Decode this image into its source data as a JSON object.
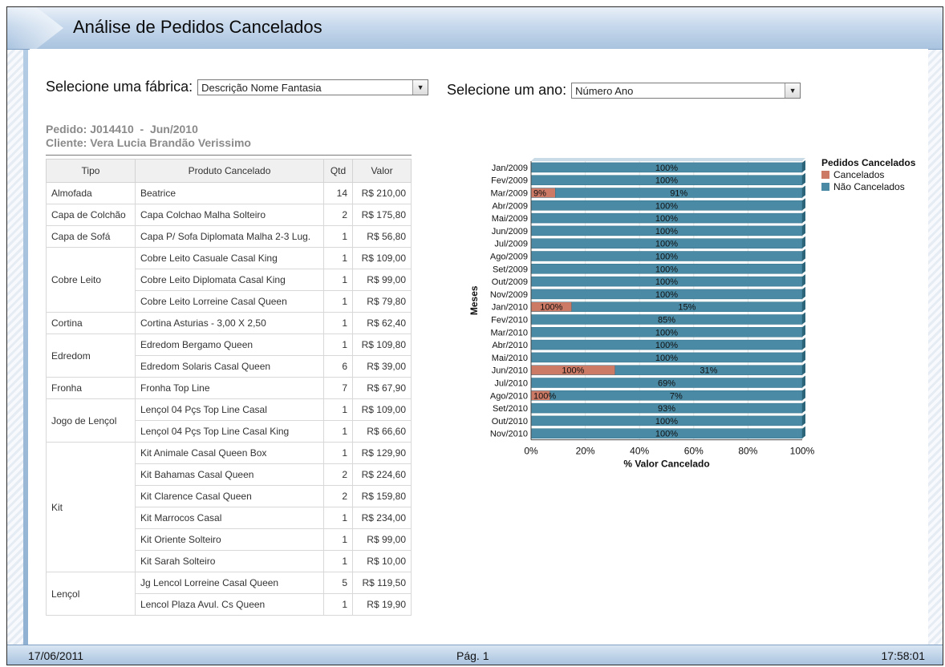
{
  "header": {
    "title": "Análise de Pedidos Cancelados"
  },
  "filters": {
    "factory_label": "Selecione uma fábrica:",
    "factory_value": "Descrição Nome Fantasia",
    "year_label": "Selecione um ano:",
    "year_value": "Número Ano"
  },
  "order": {
    "line1": "Pedido: J014410  -  Jun/2010",
    "line2": "Cliente: Vera Lucia Brandão Verissimo"
  },
  "table": {
    "headers": [
      "Tipo",
      "Produto Cancelado",
      "Qtd",
      "Valor"
    ],
    "rows": [
      {
        "tipo": "Almofada",
        "produto": "Beatrice",
        "qtd": "14",
        "valor": "R$ 210,00",
        "span": 1
      },
      {
        "tipo": "Capa de Colchão",
        "produto": "Capa Colchao Malha Solteiro",
        "qtd": "2",
        "valor": "R$ 175,80",
        "span": 1
      },
      {
        "tipo": "Capa de Sofá",
        "produto": "Capa P/ Sofa Diplomata Malha 2-3 Lug.",
        "qtd": "1",
        "valor": "R$ 56,80",
        "span": 1
      },
      {
        "tipo": "Cobre Leito",
        "produto": "Cobre Leito Casuale Casal King",
        "qtd": "1",
        "valor": "R$ 109,00",
        "span": 3
      },
      {
        "tipo": "",
        "produto": "Cobre Leito Diplomata Casal King",
        "qtd": "1",
        "valor": "R$ 99,00",
        "span": 0
      },
      {
        "tipo": "",
        "produto": "Cobre Leito Lorreine Casal Queen",
        "qtd": "1",
        "valor": "R$ 79,80",
        "span": 0
      },
      {
        "tipo": "Cortina",
        "produto": "Cortina Asturias - 3,00 X 2,50",
        "qtd": "1",
        "valor": "R$ 62,40",
        "span": 1
      },
      {
        "tipo": "Edredom",
        "produto": "Edredom Bergamo Queen",
        "qtd": "1",
        "valor": "R$ 109,80",
        "span": 2
      },
      {
        "tipo": "",
        "produto": "Edredom Solaris Casal Queen",
        "qtd": "6",
        "valor": "R$ 39,00",
        "span": 0
      },
      {
        "tipo": "Fronha",
        "produto": "Fronha Top Line",
        "qtd": "7",
        "valor": "R$ 67,90",
        "span": 1
      },
      {
        "tipo": "Jogo de Lençol",
        "produto": "Lençol 04 Pçs Top Line Casal",
        "qtd": "1",
        "valor": "R$ 109,00",
        "span": 2
      },
      {
        "tipo": "",
        "produto": "Lençol 04 Pçs Top Line Casal King",
        "qtd": "1",
        "valor": "R$ 66,60",
        "span": 0
      },
      {
        "tipo": "Kit",
        "produto": "Kit Animale Casal Queen Box",
        "qtd": "1",
        "valor": "R$ 129,90",
        "span": 6
      },
      {
        "tipo": "",
        "produto": "Kit Bahamas Casal Queen",
        "qtd": "2",
        "valor": "R$ 224,60",
        "span": 0
      },
      {
        "tipo": "",
        "produto": "Kit Clarence Casal Queen",
        "qtd": "2",
        "valor": "R$ 159,80",
        "span": 0
      },
      {
        "tipo": "",
        "produto": "Kit Marrocos Casal",
        "qtd": "1",
        "valor": "R$ 234,00",
        "span": 0
      },
      {
        "tipo": "",
        "produto": "Kit Oriente Solteiro",
        "qtd": "1",
        "valor": "R$ 99,00",
        "span": 0
      },
      {
        "tipo": "",
        "produto": "Kit Sarah Solteiro",
        "qtd": "1",
        "valor": "R$ 10,00",
        "span": 0
      },
      {
        "tipo": "Lençol",
        "produto": "Jg Lencol Lorreine Casal Queen",
        "qtd": "5",
        "valor": "R$ 119,50",
        "span": 2
      },
      {
        "tipo": "",
        "produto": "Lencol Plaza Avul. Cs Queen",
        "qtd": "1",
        "valor": "R$ 19,90",
        "span": 0
      }
    ]
  },
  "chart_data": {
    "type": "bar",
    "orientation": "horizontal",
    "stacked": true,
    "categories": [
      "Jan/2009",
      "Fev/2009",
      "Mar/2009",
      "Abr/2009",
      "Mai/2009",
      "Jun/2009",
      "Jul/2009",
      "Ago/2009",
      "Set/2009",
      "Out/2009",
      "Nov/2009",
      "Jan/2010",
      "Fev/2010",
      "Mar/2010",
      "Abr/2010",
      "Mai/2010",
      "Jun/2010",
      "Jul/2010",
      "Ago/2010",
      "Set/2010",
      "Out/2010",
      "Nov/2010"
    ],
    "series": [
      {
        "name": "Cancelados",
        "color": "#cc7a66",
        "values": [
          0,
          0,
          9,
          0,
          0,
          0,
          0,
          0,
          0,
          0,
          0,
          15,
          0,
          0,
          0,
          0,
          31,
          0,
          7,
          0,
          0,
          0
        ]
      },
      {
        "name": "Não Cancelados",
        "color": "#4a8aa5",
        "values": [
          100,
          100,
          91,
          100,
          100,
          100,
          100,
          100,
          100,
          100,
          100,
          85,
          100,
          100,
          100,
          100,
          69,
          100,
          93,
          100,
          100,
          100
        ]
      }
    ],
    "value_labels": [
      "100%",
      "100%",
      "9%",
      "91%",
      "100%",
      "100%",
      "100%",
      "100%",
      "100%",
      "100%",
      "100%",
      "100%",
      "100%",
      "15%",
      "85%",
      "100%",
      "100%",
      "100%",
      "100%",
      "31%",
      "69%",
      "100%",
      "7%",
      "93%",
      "100%",
      "100%",
      "100%"
    ],
    "xlabel": "% Valor Cancelado",
    "ylabel": "Meses",
    "xlim": [
      0,
      100
    ],
    "x_ticks": [
      "0%",
      "20%",
      "40%",
      "60%",
      "80%",
      "100%"
    ],
    "legend_title": "Pedidos Cancelados",
    "legend_position": "right"
  },
  "footer": {
    "date": "17/06/2011",
    "page": "Pág. 1",
    "time": "17:58:01"
  }
}
